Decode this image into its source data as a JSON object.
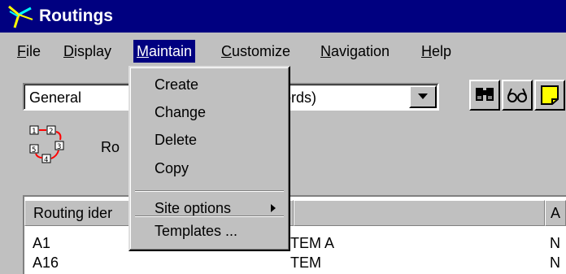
{
  "window": {
    "title": "Routings"
  },
  "menubar": {
    "items": [
      {
        "pre": "",
        "ul": "F",
        "post": "ile"
      },
      {
        "pre": "",
        "ul": "D",
        "post": "isplay"
      },
      {
        "pre": "",
        "ul": "M",
        "post": "aintain"
      },
      {
        "pre": "",
        "ul": "C",
        "post": "ustomize"
      },
      {
        "pre": "",
        "ul": "N",
        "post": "avigation"
      },
      {
        "pre": "",
        "ul": "H",
        "post": "elp"
      }
    ]
  },
  "toolbar": {
    "combo_value": "General",
    "combo_value_tail": "ords)"
  },
  "routing": {
    "label": "Ro"
  },
  "table": {
    "headers": [
      "Routing ider",
      "",
      "A"
    ],
    "rows": [
      [
        "A1",
        "TEM A",
        "N"
      ],
      [
        "A16",
        "TEM",
        "N"
      ]
    ]
  },
  "dropdown": {
    "items": [
      "Create",
      "Change",
      "Delete",
      "Copy"
    ],
    "site_options": "Site options",
    "templates": "Templates ..."
  }
}
